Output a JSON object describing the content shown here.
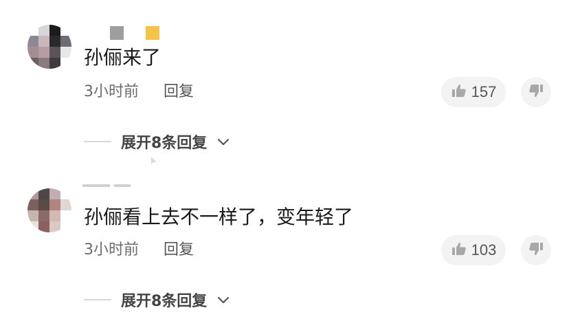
{
  "comments": [
    {
      "text": "孙俪来了",
      "time": "3小时前",
      "reply_label": "回复",
      "likes": "157",
      "expand_label": "展开8条回复",
      "avatar_icon": "blurred-avatar-icon",
      "username_icon": "blurred-username-icon"
    },
    {
      "text": "孙俪看上去不一样了，变年轻了",
      "time": "3小时前",
      "reply_label": "回复",
      "likes": "103",
      "expand_label": "展开8条回复",
      "avatar_icon": "blurred-avatar-icon",
      "username_icon": "blurred-username-icon"
    }
  ],
  "icons": {
    "like": "thumbs-up-icon",
    "dislike": "thumbs-down-icon",
    "expand": "chevron-down-icon"
  },
  "colors": {
    "text": "#1a1a1a",
    "meta": "#6b6b6b",
    "pill_bg": "#f3f3f3"
  }
}
